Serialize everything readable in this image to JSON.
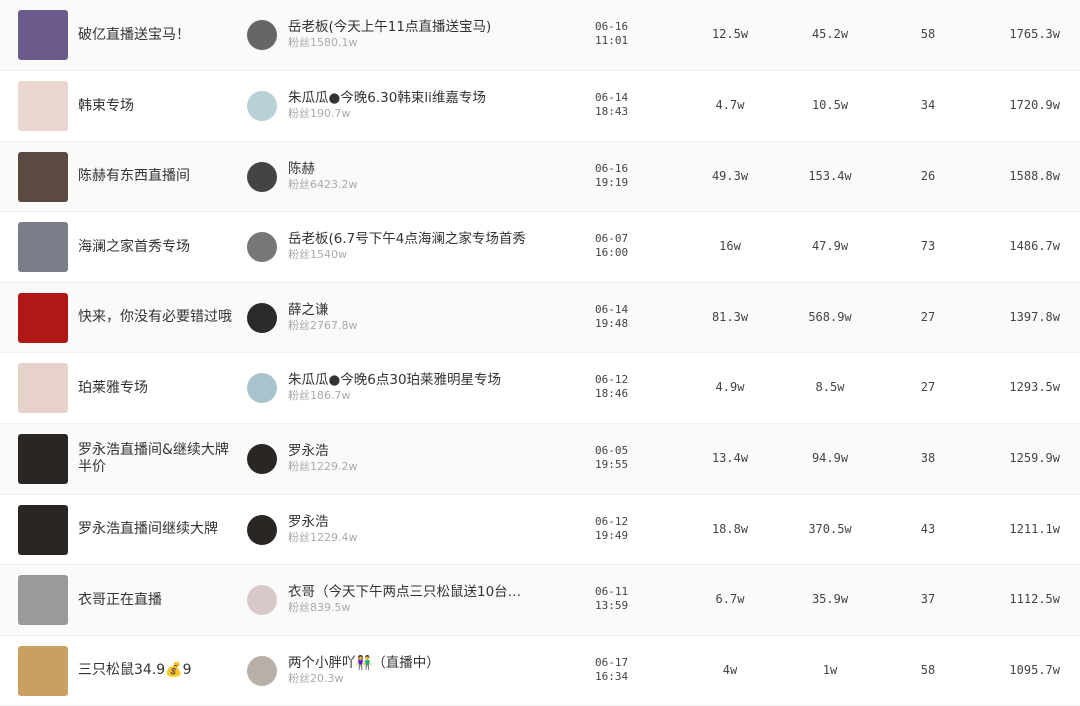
{
  "rows": [
    {
      "title": "破亿直播送宝马！",
      "anchor": "岳老板(今天上午11点直播送宝马)",
      "fans": "粉丝1580.1w",
      "date": "06-16",
      "time": "11:01",
      "v1": "12.5w",
      "v2": "45.2w",
      "v3": "58",
      "v4": "1765.3w"
    },
    {
      "title": "韩束专场",
      "anchor": "朱瓜瓜●今晚6.30韩束li维嘉专场",
      "fans": "粉丝190.7w",
      "date": "06-14",
      "time": "18:43",
      "v1": "4.7w",
      "v2": "10.5w",
      "v3": "34",
      "v4": "1720.9w"
    },
    {
      "title": "陈赫有东西直播间",
      "anchor": "陈赫",
      "fans": "粉丝6423.2w",
      "date": "06-16",
      "time": "19:19",
      "v1": "49.3w",
      "v2": "153.4w",
      "v3": "26",
      "v4": "1588.8w"
    },
    {
      "title": "海澜之家首秀专场",
      "anchor": "岳老板(6.7号下午4点海澜之家专场首秀",
      "fans": "粉丝1540w",
      "date": "06-07",
      "time": "16:00",
      "v1": "16w",
      "v2": "47.9w",
      "v3": "73",
      "v4": "1486.7w"
    },
    {
      "title": "快来，你没有必要错过哦",
      "anchor": "薛之谦",
      "fans": "粉丝2767.8w",
      "date": "06-14",
      "time": "19:48",
      "v1": "81.3w",
      "v2": "568.9w",
      "v3": "27",
      "v4": "1397.8w"
    },
    {
      "title": "珀莱雅专场",
      "anchor": "朱瓜瓜●今晚6点30珀莱雅明星专场",
      "fans": "粉丝186.7w",
      "date": "06-12",
      "time": "18:46",
      "v1": "4.9w",
      "v2": "8.5w",
      "v3": "27",
      "v4": "1293.5w"
    },
    {
      "title": "罗永浩直播间&继续大牌半价",
      "anchor": "罗永浩",
      "fans": "粉丝1229.2w",
      "date": "06-05",
      "time": "19:55",
      "v1": "13.4w",
      "v2": "94.9w",
      "v3": "38",
      "v4": "1259.9w"
    },
    {
      "title": "罗永浩直播间继续大牌",
      "anchor": "罗永浩",
      "fans": "粉丝1229.4w",
      "date": "06-12",
      "time": "19:49",
      "v1": "18.8w",
      "v2": "370.5w",
      "v3": "43",
      "v4": "1211.1w"
    },
    {
      "title": "衣哥正在直播",
      "anchor": "衣哥（今天下午两点三只松鼠送10台…",
      "fans": "粉丝839.5w",
      "date": "06-11",
      "time": "13:59",
      "v1": "6.7w",
      "v2": "35.9w",
      "v3": "37",
      "v4": "1112.5w"
    },
    {
      "title": "三只松鼠34.9💰9",
      "anchor": "两个小胖吖👫（直播中）",
      "fans": "粉丝20.3w",
      "date": "06-17",
      "time": "16:34",
      "v1": "4w",
      "v2": "1w",
      "v3": "58",
      "v4": "1095.7w"
    }
  ],
  "colors": {
    "cover": [
      "#6b5b8a",
      "#e9d6cf",
      "#5a4a40",
      "#7a7e8a",
      "#b01818",
      "#e7d2ca",
      "#2a2624",
      "#2a2624",
      "#9a9a9a",
      "#c9a060"
    ],
    "avatar": [
      "#666",
      "#b9cfd8",
      "#444",
      "#777",
      "#2b2b2b",
      "#a8c4cc",
      "#2a2624",
      "#2a2624",
      "#d9c8c8",
      "#b8b0a8"
    ]
  }
}
